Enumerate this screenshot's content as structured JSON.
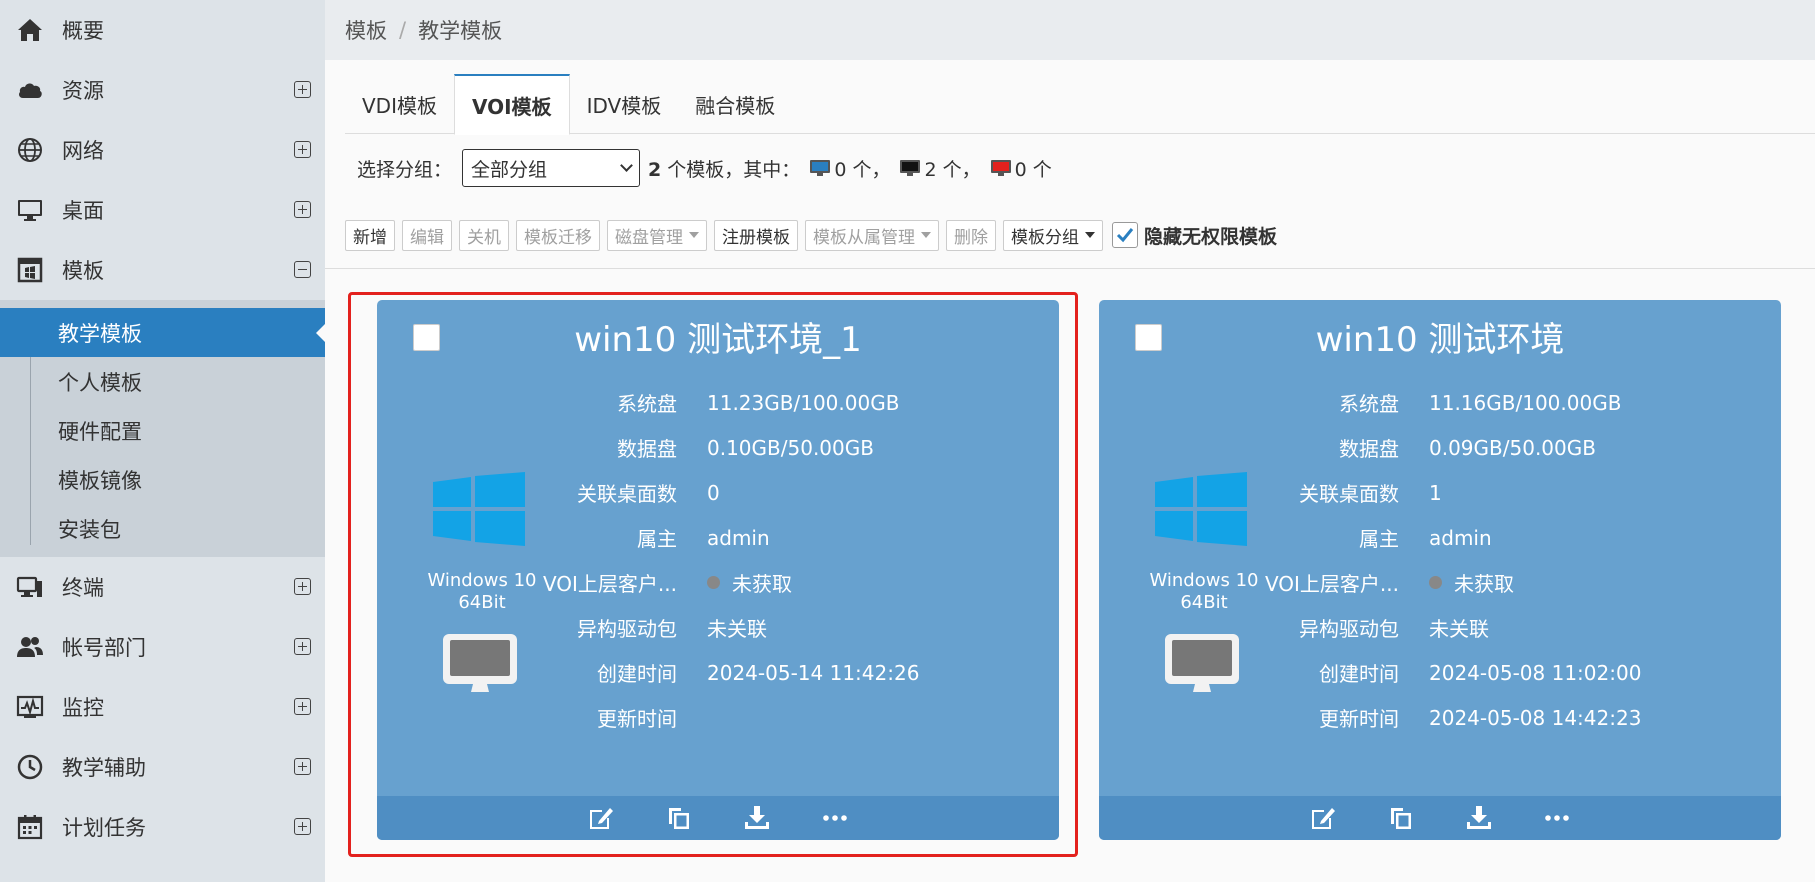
{
  "sidebar": {
    "items": [
      {
        "label": "概要",
        "icon": "home-icon",
        "toggle": "none"
      },
      {
        "label": "资源",
        "icon": "cloud-icon",
        "toggle": "plus"
      },
      {
        "label": "网络",
        "icon": "globe-icon",
        "toggle": "plus"
      },
      {
        "label": "桌面",
        "icon": "monitor-icon",
        "toggle": "plus"
      },
      {
        "label": "模板",
        "icon": "template-icon",
        "toggle": "minus"
      }
    ],
    "subitems": [
      {
        "label": "教学模板",
        "active": true
      },
      {
        "label": "个人模板"
      },
      {
        "label": "硬件配置"
      },
      {
        "label": "模板镜像"
      },
      {
        "label": "安装包"
      }
    ],
    "items2": [
      {
        "label": "终端",
        "icon": "terminal-icon"
      },
      {
        "label": "帐号部门",
        "icon": "users-icon"
      },
      {
        "label": "监控",
        "icon": "monitor-chart-icon"
      },
      {
        "label": "教学辅助",
        "icon": "clock-icon"
      },
      {
        "label": "计划任务",
        "icon": "calendar-icon"
      }
    ]
  },
  "breadcrumb": {
    "root": "模板",
    "sep": "/",
    "current": "教学模板"
  },
  "tabs": [
    "VDI模板",
    "VOI模板",
    "IDV模板",
    "融合模板"
  ],
  "active_tab": "VOI模板",
  "filter": {
    "label": "选择分组：",
    "selected": "全部分组",
    "count": "2",
    "count_text": "个模板，其中：",
    "blue_count": "0 个，",
    "black_count": "2 个，",
    "red_count": "0 个",
    "colors": {
      "blue": "#2a7fc0",
      "black": "#111111",
      "red": "#e3211d"
    }
  },
  "toolbar": {
    "new": "新增",
    "edit": "编辑",
    "shutdown": "关机",
    "migrate": "模板迁移",
    "disk": "磁盘管理",
    "register": "注册模板",
    "sub_manage": "模板从属管理",
    "delete": "删除",
    "group": "模板分组",
    "hide_label": "隐藏无权限模板"
  },
  "labels": {
    "system_disk": "系统盘",
    "data_disk": "数据盘",
    "desktops": "关联桌面数",
    "owner": "属主",
    "voi_client": "VOI上层客户...",
    "driver": "异构驱动包",
    "created": "创建时间",
    "updated": "更新时间"
  },
  "cards": [
    {
      "title": "win10 测试环境_1",
      "os_line1": "Windows 10",
      "os_line2": "64Bit",
      "system_disk": "11.23GB/100.00GB",
      "data_disk": "0.10GB/50.00GB",
      "desktops": "0",
      "owner": "admin",
      "voi_client": "未获取",
      "driver": "未关联",
      "created": "2024-05-14 11:42:26",
      "updated": ""
    },
    {
      "title": "win10 测试环境",
      "os_line1": "Windows 10",
      "os_line2": "64Bit",
      "system_disk": "11.16GB/100.00GB",
      "data_disk": "0.09GB/50.00GB",
      "desktops": "1",
      "owner": "admin",
      "voi_client": "未获取",
      "driver": "未关联",
      "created": "2024-05-08 11:02:00",
      "updated": "2024-05-08 14:42:23"
    }
  ],
  "colors": {
    "accent": "#2a7fc0",
    "card": "#67a1cf",
    "card_footer": "#4f8ec3",
    "highlight": "#e3211d",
    "windows_logo": "#13a3e6"
  }
}
